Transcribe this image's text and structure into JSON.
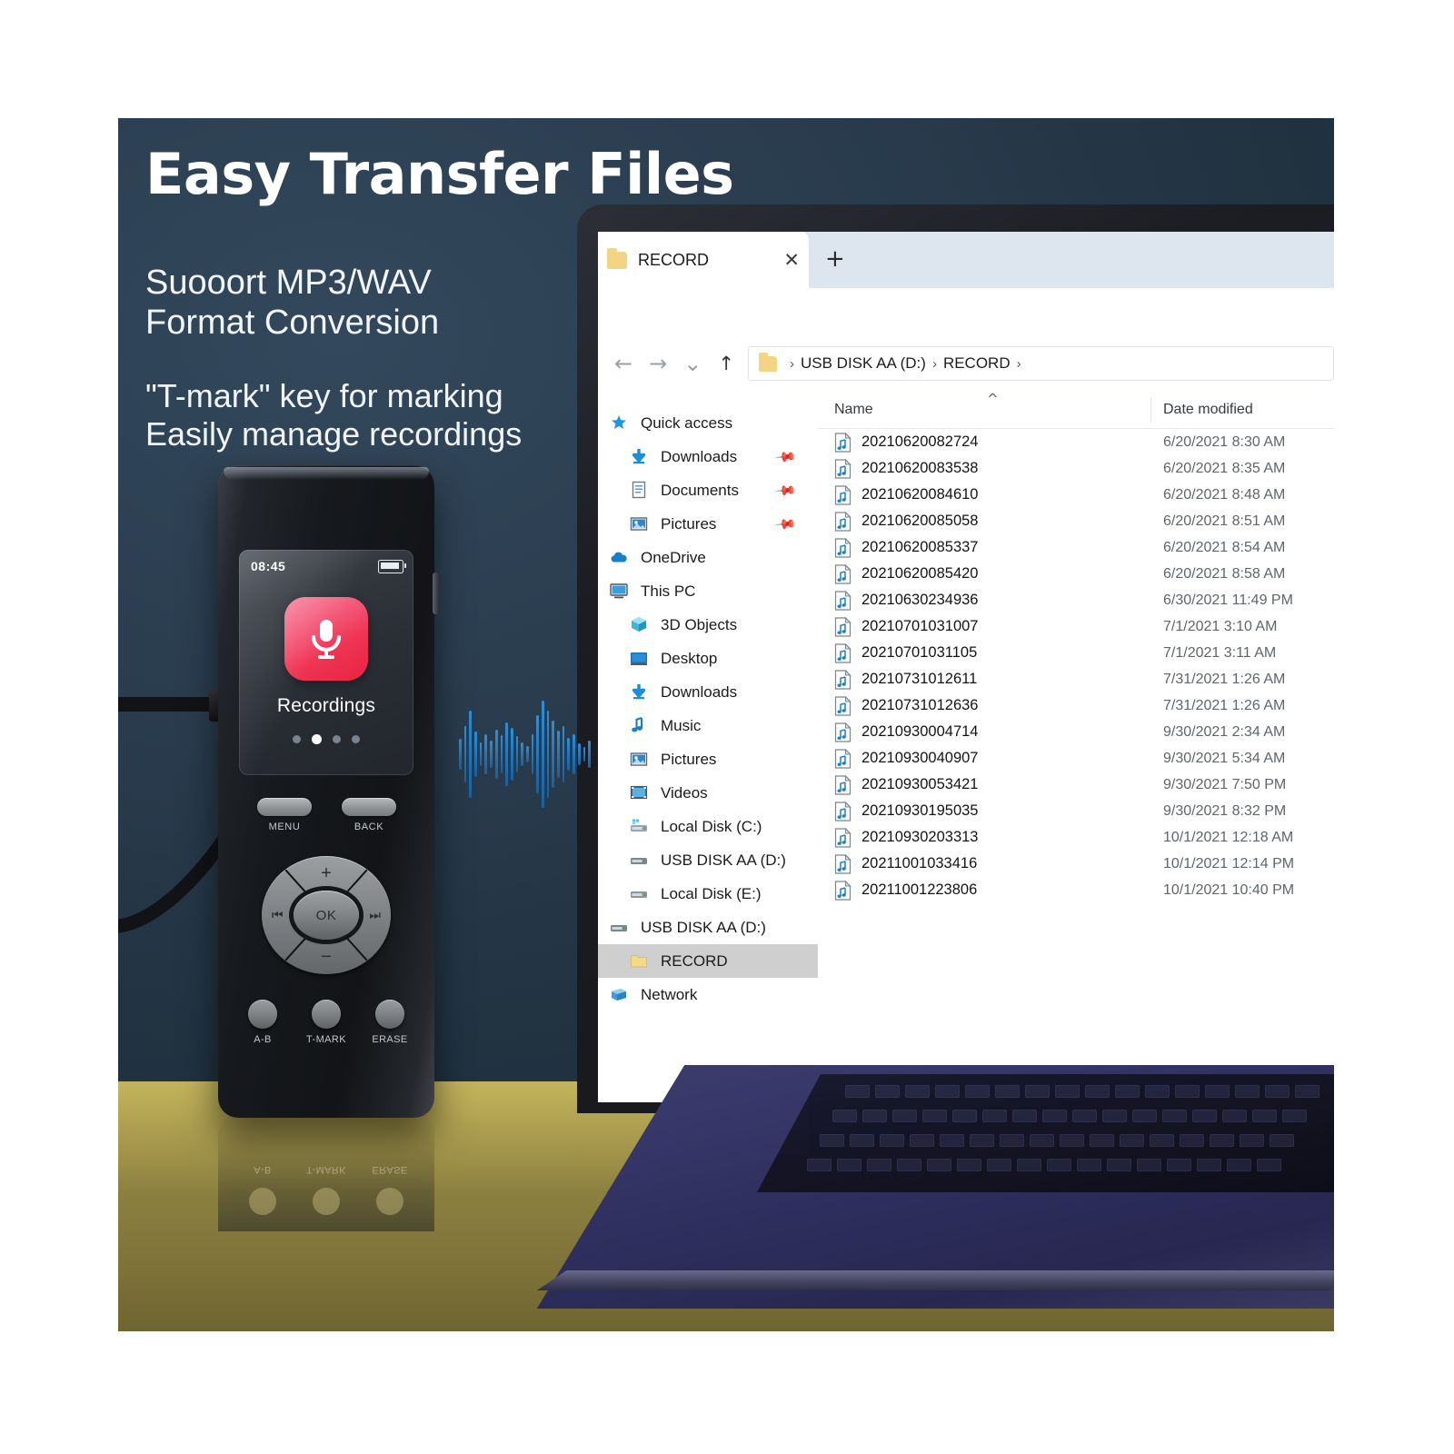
{
  "marketing": {
    "headline": "Easy Transfer Files",
    "sub_line1": "Suooort MP3/WAV",
    "sub_line2": "Format Conversion",
    "sub_line3": "\"T-mark\" key for marking",
    "sub_line4": "Easily manage recordings"
  },
  "device": {
    "screen": {
      "time": "08:45",
      "app_label": "Recordings",
      "page_dots": 4,
      "active_dot": 2,
      "icon": "microphone-icon",
      "tile_color": "#ef3455"
    },
    "buttons": {
      "menu": "MENU",
      "back": "BACK",
      "ok": "OK",
      "volume_up": "+",
      "volume_down": "−",
      "prev": "⏮",
      "next": "⏭",
      "ab": "A-B",
      "tmark": "T-MARK",
      "erase": "ERASE"
    }
  },
  "explorer": {
    "tab": {
      "title": "RECORD",
      "close": "✕",
      "new_tab": "+",
      "icon": "folder-icon"
    },
    "nav": {
      "back": "←",
      "forward": "→",
      "recent": "⌄",
      "up": "↑"
    },
    "breadcrumb": {
      "items": [
        "USB DISK AA (D:)",
        "RECORD"
      ],
      "separator": "›",
      "trailing_separator": "›"
    },
    "sidebar": [
      {
        "label": "Quick access",
        "icon": "pin-star-icon",
        "indent": 0,
        "pinned": false,
        "selected": false
      },
      {
        "label": "Downloads",
        "icon": "download-arrow-icon",
        "indent": 1,
        "pinned": true,
        "selected": false
      },
      {
        "label": "Documents",
        "icon": "document-icon",
        "indent": 1,
        "pinned": true,
        "selected": false
      },
      {
        "label": "Pictures",
        "icon": "pictures-icon",
        "indent": 1,
        "pinned": true,
        "selected": false
      },
      {
        "label": "OneDrive",
        "icon": "cloud-icon",
        "indent": 0,
        "pinned": false,
        "selected": false
      },
      {
        "label": "This PC",
        "icon": "monitor-icon",
        "indent": 0,
        "pinned": false,
        "selected": false
      },
      {
        "label": "3D Objects",
        "icon": "cube-icon",
        "indent": 1,
        "pinned": false,
        "selected": false
      },
      {
        "label": "Desktop",
        "icon": "desktop-icon",
        "indent": 1,
        "pinned": false,
        "selected": false
      },
      {
        "label": "Downloads",
        "icon": "download-arrow-icon",
        "indent": 1,
        "pinned": false,
        "selected": false
      },
      {
        "label": "Music",
        "icon": "music-note-icon",
        "indent": 1,
        "pinned": false,
        "selected": false
      },
      {
        "label": "Pictures",
        "icon": "pictures-icon",
        "indent": 1,
        "pinned": false,
        "selected": false
      },
      {
        "label": "Videos",
        "icon": "videos-icon",
        "indent": 1,
        "pinned": false,
        "selected": false
      },
      {
        "label": "Local Disk (C:)",
        "icon": "system-drive-icon",
        "indent": 1,
        "pinned": false,
        "selected": false
      },
      {
        "label": "USB DISK AA (D:)",
        "icon": "usb-drive-icon",
        "indent": 1,
        "pinned": false,
        "selected": false
      },
      {
        "label": "Local Disk (E:)",
        "icon": "drive-icon",
        "indent": 1,
        "pinned": false,
        "selected": false
      },
      {
        "label": "USB DISK AA (D:)",
        "icon": "usb-drive-icon",
        "indent": 0,
        "pinned": false,
        "selected": false
      },
      {
        "label": "RECORD",
        "icon": "folder-icon",
        "indent": 1,
        "pinned": false,
        "selected": true
      },
      {
        "label": "Network",
        "icon": "network-icon",
        "indent": 0,
        "pinned": false,
        "selected": false
      }
    ],
    "columns": [
      "Name",
      "Date modified"
    ],
    "sort_column": "Name",
    "sort_direction": "ascending",
    "files": [
      {
        "name": "20210620082724",
        "date": "6/20/2021 8:30 AM"
      },
      {
        "name": "20210620083538",
        "date": "6/20/2021 8:35 AM"
      },
      {
        "name": "20210620084610",
        "date": "6/20/2021 8:48 AM"
      },
      {
        "name": "20210620085058",
        "date": "6/20/2021 8:51 AM"
      },
      {
        "name": "20210620085337",
        "date": "6/20/2021 8:54 AM"
      },
      {
        "name": "20210620085420",
        "date": "6/20/2021 8:58 AM"
      },
      {
        "name": "20210630234936",
        "date": "6/30/2021 11:49 PM"
      },
      {
        "name": "20210701031007",
        "date": "7/1/2021 3:10 AM"
      },
      {
        "name": "20210701031105",
        "date": "7/1/2021 3:11 AM"
      },
      {
        "name": "20210731012611",
        "date": "7/31/2021 1:26 AM"
      },
      {
        "name": "20210731012636",
        "date": "7/31/2021 1:26 AM"
      },
      {
        "name": "20210930004714",
        "date": "9/30/2021 2:34 AM"
      },
      {
        "name": "20210930040907",
        "date": "9/30/2021 5:34 AM"
      },
      {
        "name": "20210930053421",
        "date": "9/30/2021 7:50 PM"
      },
      {
        "name": "20210930195035",
        "date": "9/30/2021 8:32 PM"
      },
      {
        "name": "20210930203313",
        "date": "10/1/2021 12:18 AM"
      },
      {
        "name": "20211001033416",
        "date": "10/1/2021 12:14 PM"
      },
      {
        "name": "20211001223806",
        "date": "10/1/2021 10:40 PM"
      }
    ]
  },
  "colors": {
    "panel_bg": "#2a3d4f",
    "desk": "#8c8040",
    "laptop_base": "#2e2e5d",
    "accent_red": "#ef3455",
    "waveform": "#2f8fd6",
    "folder_yellow": "#f3d484"
  },
  "waveform": {
    "label": "audio-waveform",
    "bars": [
      34,
      62,
      96,
      50,
      26,
      44,
      30,
      54,
      42,
      70,
      58,
      40,
      26,
      18,
      44,
      86,
      118,
      96,
      74,
      52,
      62,
      36,
      44,
      24,
      16,
      30
    ]
  }
}
